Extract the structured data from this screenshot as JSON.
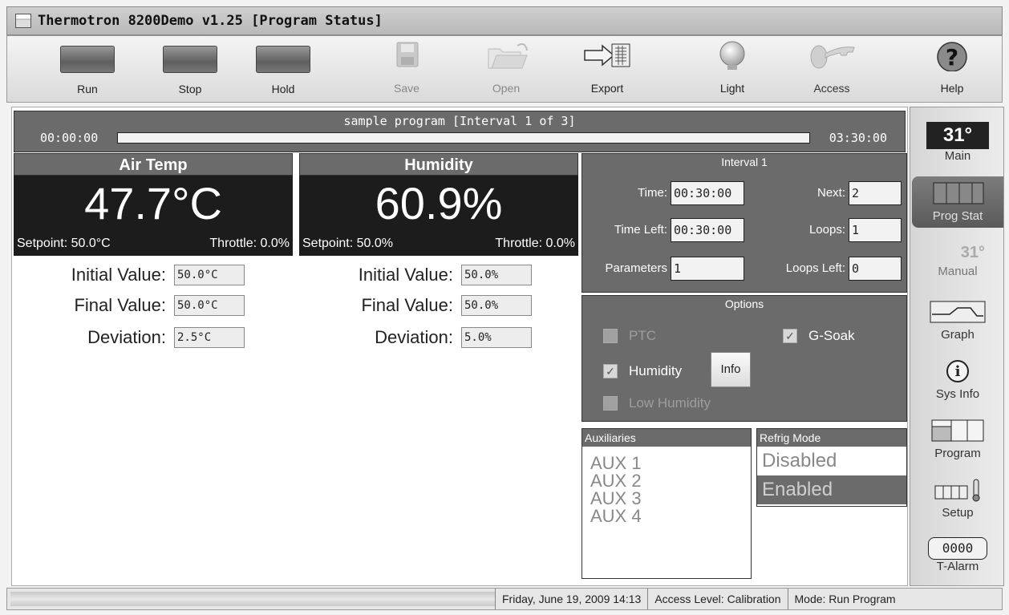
{
  "window": {
    "title": "Thermotron 8200Demo  v1.25 [Program Status]"
  },
  "toolbar": {
    "run": "Run",
    "stop": "Stop",
    "hold": "Hold",
    "save": "Save",
    "open": "Open",
    "export": "Export",
    "light": "Light",
    "access": "Access",
    "help": "Help"
  },
  "program": {
    "name": "sample program [Interval 1 of 3]",
    "start_time": "00:00:00",
    "end_time": "03:30:00",
    "progress": 0.0
  },
  "air_temp": {
    "header": "Air Temp",
    "value": "47.7°C",
    "setpoint": "Setpoint: 50.0°C",
    "throttle": "Throttle: 0.0%",
    "initial_label": "Initial Value:",
    "initial_value": "50.0°C",
    "final_label": "Final Value:",
    "final_value": "50.0°C",
    "deviation_label": "Deviation:",
    "deviation_value": "2.5°C"
  },
  "humidity": {
    "header": "Humidity",
    "value": "60.9%",
    "setpoint": "Setpoint: 50.0%",
    "throttle": "Throttle: 0.0%",
    "initial_label": "Initial Value:",
    "initial_value": "50.0%",
    "final_label": "Final Value:",
    "final_value": "50.0%",
    "deviation_label": "Deviation:",
    "deviation_value": "5.0%"
  },
  "interval": {
    "title": "Interval 1",
    "time_label": "Time:",
    "time_value": "00:30:00",
    "time_left_label": "Time Left:",
    "time_left_value": "00:30:00",
    "parameters_label": "Parameters",
    "parameters_value": "1",
    "next_label": "Next:",
    "next_value": "2",
    "loops_label": "Loops:",
    "loops_value": "1",
    "loops_left_label": "Loops Left:",
    "loops_left_value": "0"
  },
  "options": {
    "title": "Options",
    "ptc": "PTC",
    "g_soak": "G-Soak",
    "humidity": "Humidity",
    "low_humidity": "Low Humidity",
    "info": "Info",
    "check_mark": "✓"
  },
  "auxiliaries": {
    "header": "Auxiliaries",
    "items": [
      "AUX 1",
      "AUX 2",
      "AUX 3",
      "AUX 4"
    ]
  },
  "refrig": {
    "header": "Refrig Mode",
    "disabled": "Disabled",
    "enabled": "Enabled"
  },
  "nav": {
    "main": "Main",
    "main_temp": "31°",
    "prog_stat": "Prog Stat",
    "manual": "Manual",
    "manual_temp": "31°",
    "graph": "Graph",
    "sys_info": "Sys Info",
    "program": "Program",
    "setup": "Setup",
    "t_alarm": "T-Alarm",
    "t_alarm_digits": "0000"
  },
  "status": {
    "datetime": "Friday, June 19, 2009 14:13",
    "access_level": "Access Level: Calibration",
    "mode": "Mode: Run Program"
  },
  "colors": {
    "panel": "#6b6b6b",
    "readout_bg": "#1c1c1c",
    "active_nav": "#5a5a5a"
  }
}
